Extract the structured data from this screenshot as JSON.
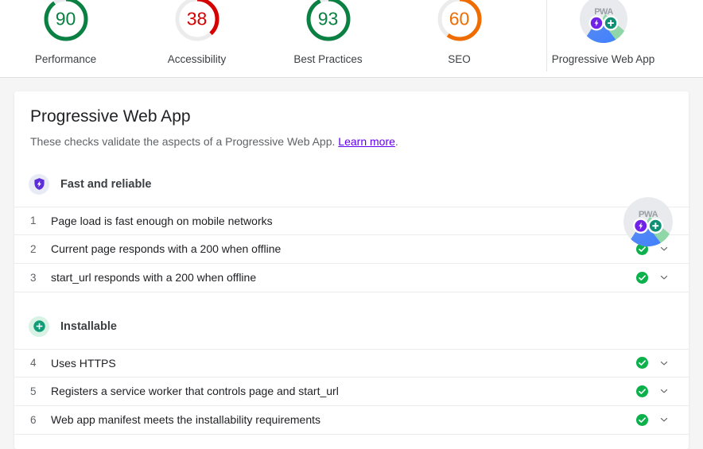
{
  "scores": {
    "divider_after_index": 3,
    "items": [
      {
        "label": "Performance",
        "value": "90",
        "color": "#0b8043",
        "track": "#e8eaed",
        "icon": "gauge-arc-icon"
      },
      {
        "label": "Accessibility",
        "value": "38",
        "color": "#d50000",
        "track": "#ececec",
        "icon": "gauge-arc-icon"
      },
      {
        "label": "Best Practices",
        "value": "93",
        "color": "#0b8043",
        "track": "#e8eaed",
        "icon": "gauge-arc-icon"
      },
      {
        "label": "SEO",
        "value": "60",
        "color": "#ef6c00",
        "track": "#ececec",
        "icon": "gauge-arc-icon"
      },
      {
        "label": "Progressive Web App",
        "value": "",
        "color": "",
        "track": "",
        "icon": "pwa-badge-icon"
      }
    ]
  },
  "report": {
    "title": "Progressive Web App",
    "description_before": "These checks validate the aspects of a Progressive Web App. ",
    "learn_more_label": "Learn more",
    "description_after": ".",
    "badge_icon": "pwa-badge-icon",
    "badge_text": "PWA"
  },
  "sections": [
    {
      "title": "Fast and reliable",
      "icon": "shield-bolt-icon",
      "icon_color": "#5c2ed8",
      "icon_bg": "#e8eaf6",
      "audits": [
        {
          "index": "1",
          "title": "Page load is fast enough on mobile networks",
          "status": "pass",
          "status_icon": "check-circle-icon",
          "expand_icon": "chevron-down-icon"
        },
        {
          "index": "2",
          "title": "Current page responds with a 200 when offline",
          "status": "pass",
          "status_icon": "check-circle-icon",
          "expand_icon": "chevron-down-icon"
        },
        {
          "index": "3",
          "title": "start_url responds with a 200 when offline",
          "status": "pass",
          "status_icon": "check-circle-icon",
          "expand_icon": "chevron-down-icon"
        }
      ]
    },
    {
      "title": "Installable",
      "icon": "plus-circle-icon",
      "icon_color": "#0f9d78",
      "icon_bg": "#d9f2e6",
      "audits": [
        {
          "index": "4",
          "title": "Uses HTTPS",
          "status": "pass",
          "status_icon": "check-circle-icon",
          "expand_icon": "chevron-down-icon"
        },
        {
          "index": "5",
          "title": "Registers a service worker that controls page and start_url",
          "status": "pass",
          "status_icon": "check-circle-icon",
          "expand_icon": "chevron-down-icon"
        },
        {
          "index": "6",
          "title": "Web app manifest meets the installability requirements",
          "status": "pass",
          "status_icon": "check-circle-icon",
          "expand_icon": "chevron-down-icon"
        }
      ]
    }
  ],
  "colors": {
    "pass_green": "#0cb14b",
    "link_purple": "#6200ee",
    "text_primary": "#202124",
    "text_secondary": "#5f6368"
  }
}
